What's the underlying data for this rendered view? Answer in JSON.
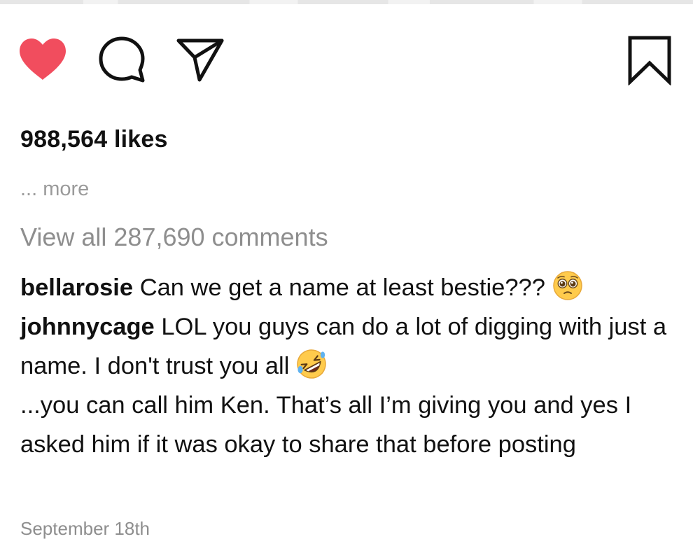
{
  "post": {
    "likes_text": "988,564 likes",
    "more_text": "... more",
    "view_all_text": "View all 287,690 comments",
    "date": "September 18th"
  },
  "actions": {
    "like_icon": "heart-filled-icon",
    "comment_icon": "comment-bubble-icon",
    "share_icon": "paper-plane-icon",
    "save_icon": "bookmark-icon",
    "like_color": "#F14D5E"
  },
  "comments": [
    {
      "username": "bellarosie",
      "text": "Can we get a name at least bestie???",
      "emoji": "pleading-face-emoji"
    },
    {
      "username": "johnnycage",
      "text": "LOL you guys can do a lot of digging with just a name. I don't trust you all",
      "emoji": "rolling-on-floor-laughing-emoji",
      "continuation": "...you can call him Ken. That’s all I’m giving you and yes I asked him if it was okay to share that before posting"
    }
  ]
}
